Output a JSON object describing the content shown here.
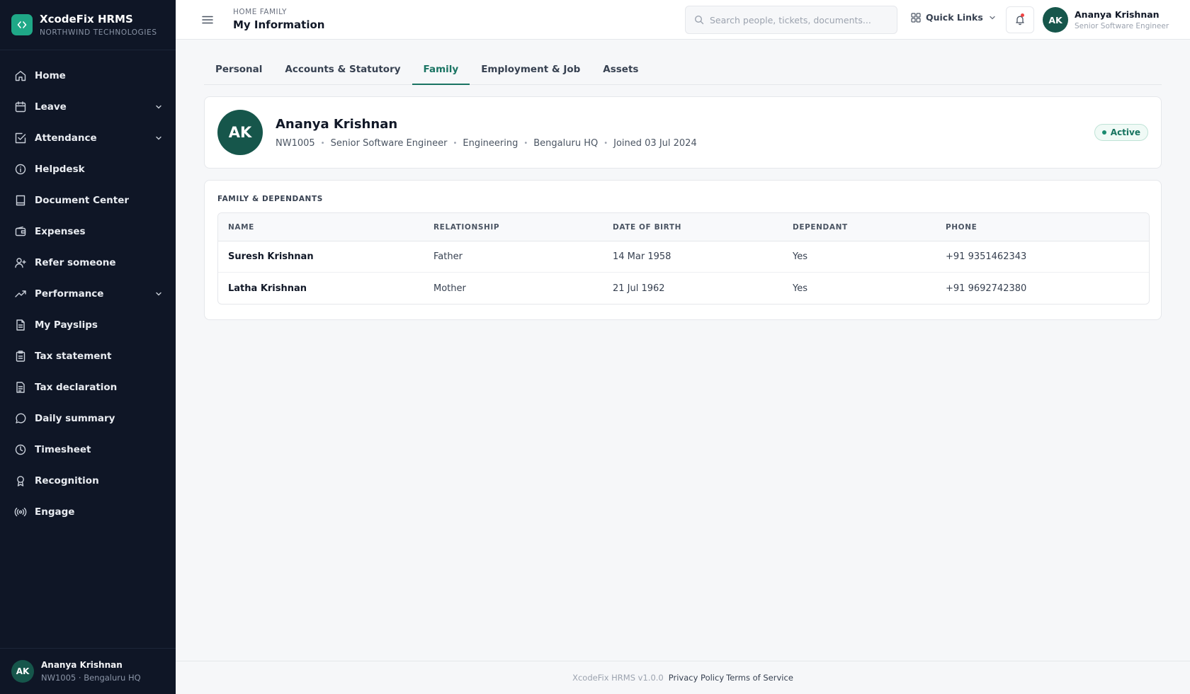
{
  "brand": {
    "name": "XcodeFix HRMS",
    "org": "NORTHWIND TECHNOLOGIES"
  },
  "sidebar": {
    "items": [
      {
        "label": "Home",
        "icon": "home-icon",
        "expandable": false
      },
      {
        "label": "Leave",
        "icon": "calendar-icon",
        "expandable": true
      },
      {
        "label": "Attendance",
        "icon": "check-square-icon",
        "expandable": true
      },
      {
        "label": "Helpdesk",
        "icon": "info-icon",
        "expandable": false
      },
      {
        "label": "Document Center",
        "icon": "book-icon",
        "expandable": false
      },
      {
        "label": "Expenses",
        "icon": "wallet-icon",
        "expandable": false
      },
      {
        "label": "Refer someone",
        "icon": "user-plus-icon",
        "expandable": false
      },
      {
        "label": "Performance",
        "icon": "trending-up-icon",
        "expandable": true
      },
      {
        "label": "My Payslips",
        "icon": "file-icon",
        "expandable": false
      },
      {
        "label": "Tax statement",
        "icon": "clipboard-icon",
        "expandable": false
      },
      {
        "label": "Tax declaration",
        "icon": "file-text-icon",
        "expandable": false
      },
      {
        "label": "Daily summary",
        "icon": "message-circle-icon",
        "expandable": false
      },
      {
        "label": "Timesheet",
        "icon": "clock-icon",
        "expandable": false
      },
      {
        "label": "Recognition",
        "icon": "award-icon",
        "expandable": false
      },
      {
        "label": "Engage",
        "icon": "broadcast-icon",
        "expandable": false
      }
    ],
    "footer": {
      "initials": "AK",
      "name": "Ananya Krishnan",
      "sub": "NW1005 · Bengaluru HQ"
    }
  },
  "header": {
    "breadcrumb": "HOME FAMILY",
    "title": "My Information",
    "search_placeholder": "Search people, tickets, documents...",
    "quick_links": "Quick Links",
    "user": {
      "initials": "AK",
      "name": "Ananya Krishnan",
      "role": "Senior Software Engineer"
    }
  },
  "tabs": [
    {
      "label": "Personal",
      "active": false
    },
    {
      "label": "Accounts & Statutory",
      "active": false
    },
    {
      "label": "Family",
      "active": true
    },
    {
      "label": "Employment & Job",
      "active": false
    },
    {
      "label": "Assets",
      "active": false
    }
  ],
  "profile": {
    "initials": "AK",
    "name": "Ananya Krishnan",
    "meta": [
      "NW1005",
      "Senior Software Engineer",
      "Engineering",
      "Bengaluru HQ",
      "Joined 03 Jul 2024"
    ],
    "status": "Active"
  },
  "family": {
    "title": "FAMILY & DEPENDANTS",
    "columns": [
      "NAME",
      "RELATIONSHIP",
      "DATE OF BIRTH",
      "DEPENDANT",
      "PHONE"
    ],
    "rows": [
      [
        "Suresh Krishnan",
        "Father",
        "14 Mar 1958",
        "Yes",
        "+91 9351462343"
      ],
      [
        "Latha Krishnan",
        "Mother",
        "21 Jul 1962",
        "Yes",
        "+91 9692742380"
      ]
    ]
  },
  "footer": {
    "version": "XcodeFix HRMS v1.0.0",
    "privacy": "Privacy Policy",
    "terms": "Terms of Service"
  },
  "colors": {
    "sidebar": "#0f1626",
    "accent": "#1a7463",
    "avatar": "#16564b",
    "logo": "#1fa887"
  }
}
